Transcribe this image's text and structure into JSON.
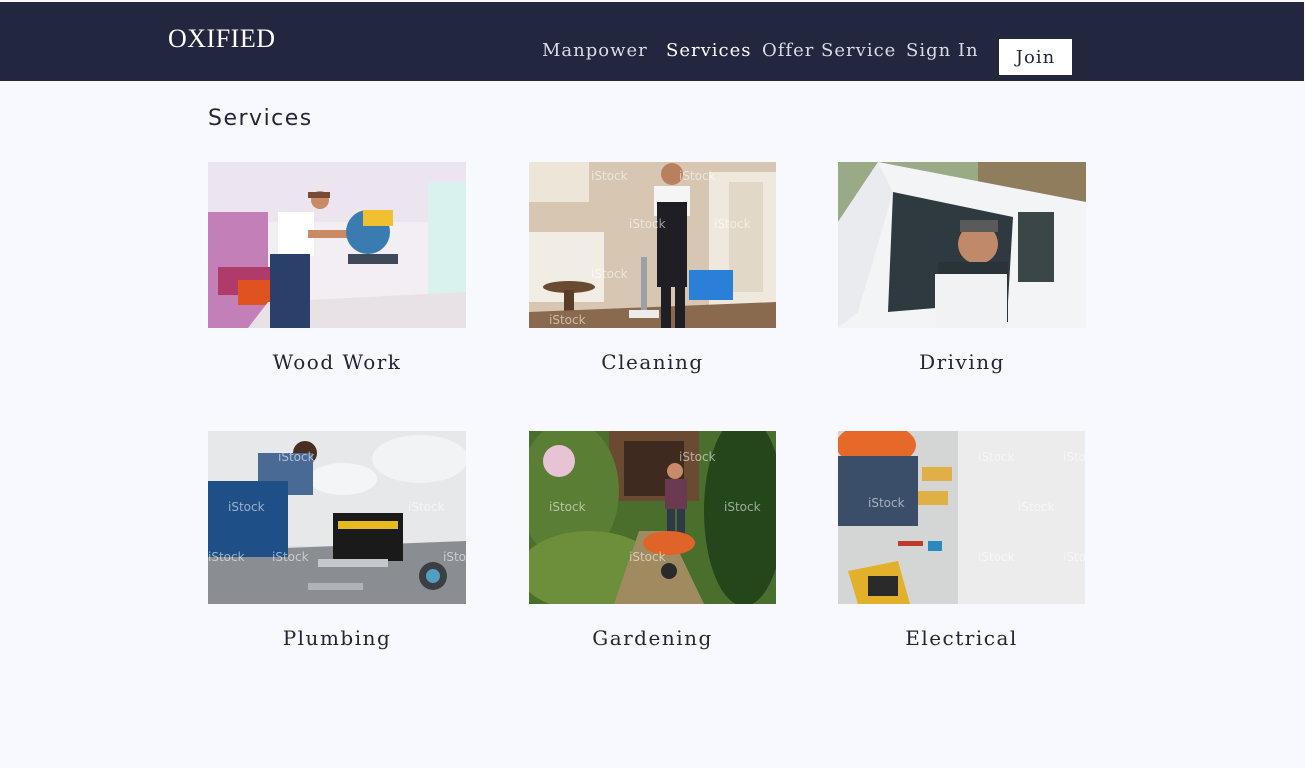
{
  "header": {
    "brand": "OXIFIED",
    "nav": [
      {
        "label": "Manpower"
      },
      {
        "label": "Services"
      },
      {
        "label": "Offer Service"
      },
      {
        "label": "Sign In"
      }
    ],
    "join_label": "Join"
  },
  "main": {
    "title": "Services",
    "services": [
      {
        "label": "Wood Work",
        "watermark": ""
      },
      {
        "label": "Cleaning",
        "watermark": "iStock"
      },
      {
        "label": "Driving",
        "watermark": ""
      },
      {
        "label": "Plumbing",
        "watermark": "iStock"
      },
      {
        "label": "Gardening",
        "watermark": "iStock"
      },
      {
        "label": "Electrical",
        "watermark": "iStock"
      }
    ]
  },
  "colors": {
    "header_bg": "#23263f",
    "page_bg": "#f8f9fe",
    "text": "#23263a"
  }
}
